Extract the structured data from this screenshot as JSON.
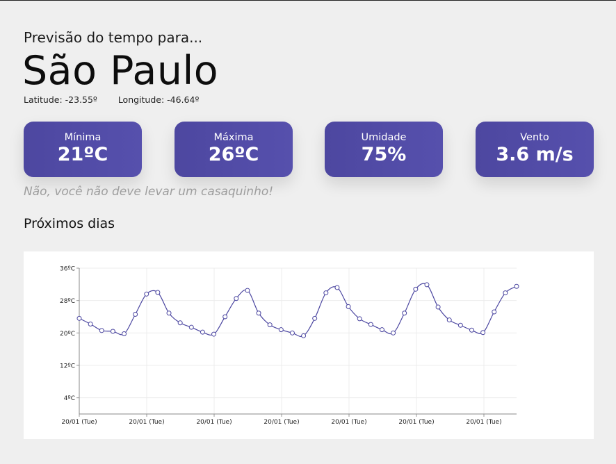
{
  "header": {
    "subtitle": "Previsão do tempo para...",
    "city": "São Paulo",
    "latitude": "Latitude: -23.55º",
    "longitude": "Longitude: -46.64º"
  },
  "cards": [
    {
      "label": "Mínima",
      "value": "21ºC"
    },
    {
      "label": "Máxima",
      "value": "26ºC"
    },
    {
      "label": "Umidade",
      "value": "75%"
    },
    {
      "label": "Vento",
      "value": "3.6 m/s"
    }
  ],
  "hint": "Não, você não deve levar um casaquinho!",
  "section_title": "Próximos dias",
  "colors": {
    "background": "#efefef",
    "card": "#5049a5",
    "hint": "#9e9e9e",
    "line": "#4b46a0"
  },
  "chart_data": {
    "type": "line",
    "title": "",
    "xlabel": "",
    "ylabel": "",
    "ylim": [
      0,
      36
    ],
    "ytick_labels": [
      "36ºC",
      "28ºC",
      "20ºC",
      "12ºC",
      "4ºC"
    ],
    "ytick_values": [
      36,
      28,
      20,
      12,
      4
    ],
    "xtick_labels": [
      "20/01 (Tue)",
      "20/01 (Tue)",
      "20/01 (Tue)",
      "20/01 (Tue)",
      "20/01 (Tue)",
      "20/01 (Tue)",
      "20/01 (Tue)"
    ],
    "grid": true,
    "series": [
      {
        "values": [
          23.6,
          22.2,
          20.6,
          20.4,
          19.8,
          24.6,
          29.6,
          30.0,
          24.9,
          22.5,
          21.4,
          20.2,
          19.7,
          24.0,
          28.5,
          30.5,
          24.9,
          22.0,
          20.8,
          20.0,
          19.3,
          23.6,
          29.9,
          31.2,
          26.5,
          23.5,
          22.1,
          20.8,
          20.0,
          24.9,
          30.8,
          31.9,
          26.4,
          23.2,
          21.9,
          20.7,
          20.1,
          25.2,
          29.9,
          31.5
        ]
      }
    ]
  }
}
